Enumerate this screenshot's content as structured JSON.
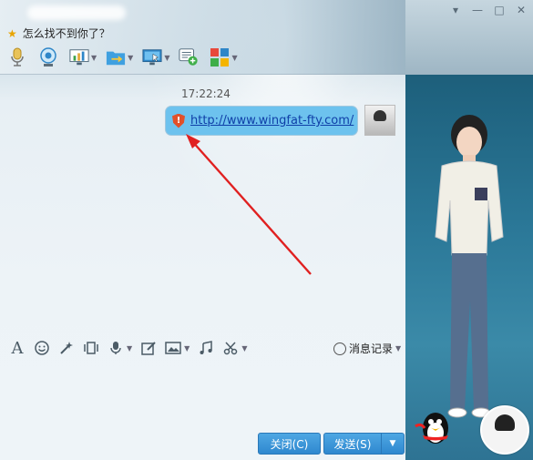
{
  "window": {
    "status_message": "怎么找不到你了？",
    "controls": [
      "▾",
      "—",
      "□",
      "✕"
    ]
  },
  "toolbar": {
    "items": [
      {
        "icon": "microphone-icon",
        "has_dropdown": false
      },
      {
        "icon": "webcam-icon",
        "has_dropdown": false
      },
      {
        "icon": "screen-share-icon",
        "has_dropdown": true
      },
      {
        "icon": "file-transfer-icon",
        "has_dropdown": true
      },
      {
        "icon": "remote-desktop-icon",
        "has_dropdown": true
      },
      {
        "icon": "create-discussion-icon",
        "has_dropdown": false
      },
      {
        "icon": "apps-icon",
        "has_dropdown": true
      }
    ]
  },
  "chat": {
    "timestamp": "17:22:24",
    "message_link": "http://www.wingfat-fty.com/",
    "colors": {
      "bubble": "#6dc2ee",
      "annotation_arrow": "#e02020"
    }
  },
  "input_toolbar": {
    "items": [
      "font-icon",
      "emoji-icon",
      "magic-expression-icon",
      "shake-window-icon",
      "voice-icon",
      "handwriting-icon",
      "image-icon",
      "music-icon",
      "screenshot-icon"
    ],
    "history_label": "消息记录"
  },
  "buttons": {
    "close_label": "关闭(C)",
    "send_label": "发送(S)",
    "send_menu_label": "▼"
  }
}
